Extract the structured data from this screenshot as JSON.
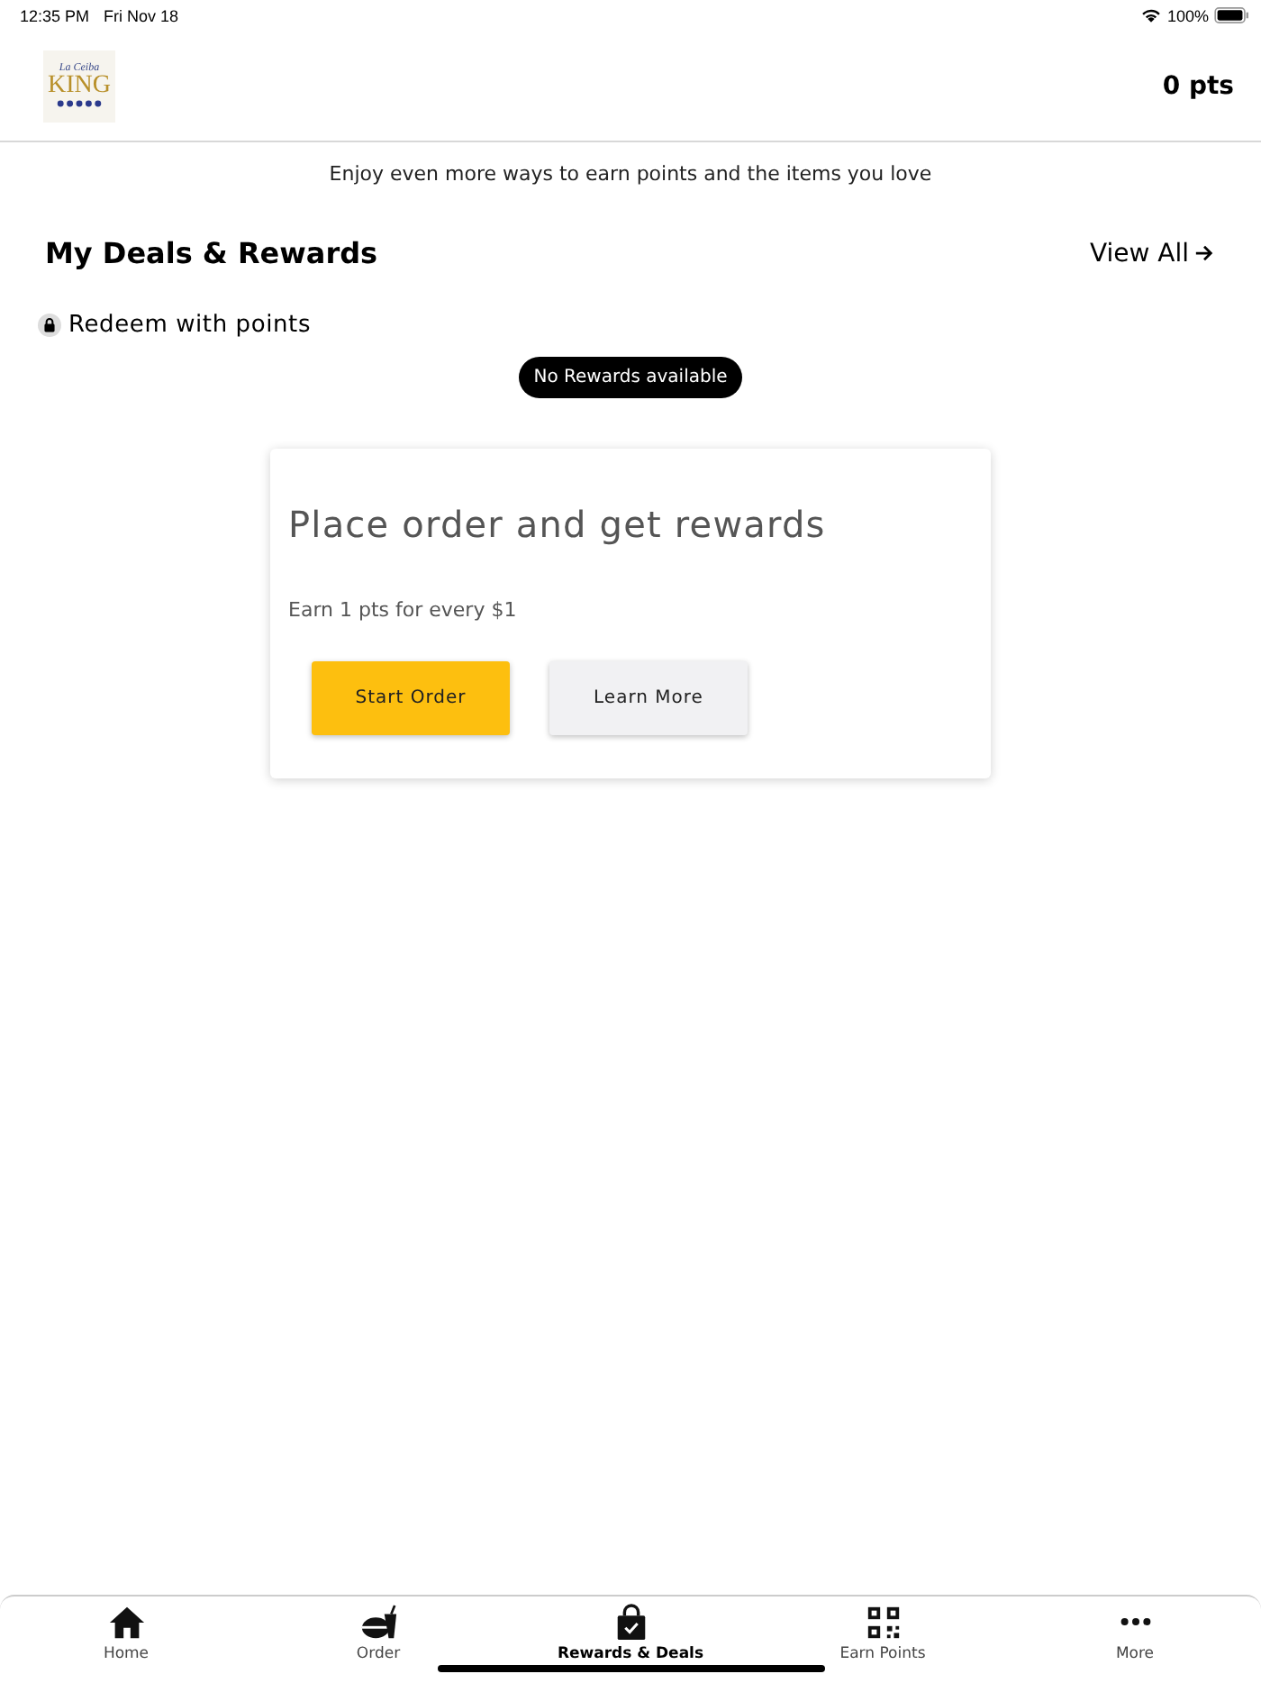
{
  "status_bar": {
    "time": "12:35 PM",
    "date": "Fri Nov 18",
    "battery": "100%"
  },
  "header": {
    "logo_top": "La Ceiba",
    "logo_main": "KING",
    "points": "0  pts"
  },
  "tagline": "Enjoy even more ways to earn points and the items you love",
  "deals": {
    "title": "My Deals & Rewards",
    "view_all": "View All",
    "redeem_label": "Redeem with points",
    "empty_badge": "No Rewards available"
  },
  "card": {
    "title": "Place order and get rewards",
    "subtitle": "Earn 1 pts for every $1",
    "buttons": [
      {
        "label": "Start Order",
        "kind": "primary"
      },
      {
        "label": "Learn More",
        "kind": "secondary"
      }
    ]
  },
  "tab_bar": [
    {
      "label": "Home",
      "kind": "home",
      "selected": false
    },
    {
      "label": "Order",
      "kind": "order",
      "selected": false
    },
    {
      "label": "Rewards & Deals",
      "kind": "bag",
      "selected": true
    },
    {
      "label": "Earn Points",
      "kind": "qr",
      "selected": false
    },
    {
      "label": "More",
      "kind": "more",
      "selected": false
    }
  ]
}
